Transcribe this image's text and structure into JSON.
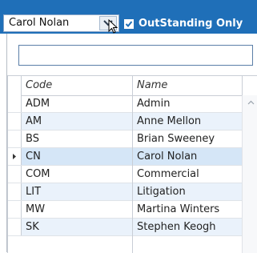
{
  "toolbar": {
    "user_select_value": "Carol Nolan",
    "outstanding_label": "OutStanding Only",
    "outstanding_checked": true
  },
  "search": {
    "value": "",
    "placeholder": ""
  },
  "table": {
    "columns": [
      "Code",
      "Name"
    ],
    "rows": [
      {
        "code": "ADM",
        "name": "Admin"
      },
      {
        "code": "AM",
        "name": "Anne Mellon"
      },
      {
        "code": "BS",
        "name": "Brian Sweeney"
      },
      {
        "code": "CN",
        "name": "Carol Nolan",
        "selected": true
      },
      {
        "code": "COM",
        "name": "Commercial"
      },
      {
        "code": "LIT",
        "name": "Litigation"
      },
      {
        "code": "MW",
        "name": "Martina Winters"
      },
      {
        "code": "SK",
        "name": "Stephen Keogh"
      }
    ]
  },
  "colors": {
    "toolbar_bg": "#1f6fb8",
    "row_alt": "#eaf2fb",
    "row_selected": "#d5e6f7"
  }
}
